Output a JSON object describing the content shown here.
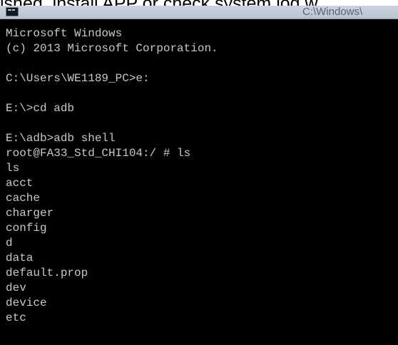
{
  "page": {
    "article_text": "ished, install APP or check system log w"
  },
  "window": {
    "title": "C:\\Windows\\",
    "icon": "cmd-console-icon"
  },
  "console": {
    "lines": [
      "Microsoft Windows",
      "(c) 2013 Microsoft Corporation.",
      "",
      "C:\\Users\\WE1189_PC>e:",
      "",
      "E:\\>cd adb",
      "",
      "E:\\adb>adb shell",
      "root@FA33_Std_CHI104:/ # ls",
      "ls",
      "acct",
      "cache",
      "charger",
      "config",
      "d",
      "data",
      "default.prop",
      "dev",
      "device",
      "etc"
    ]
  }
}
